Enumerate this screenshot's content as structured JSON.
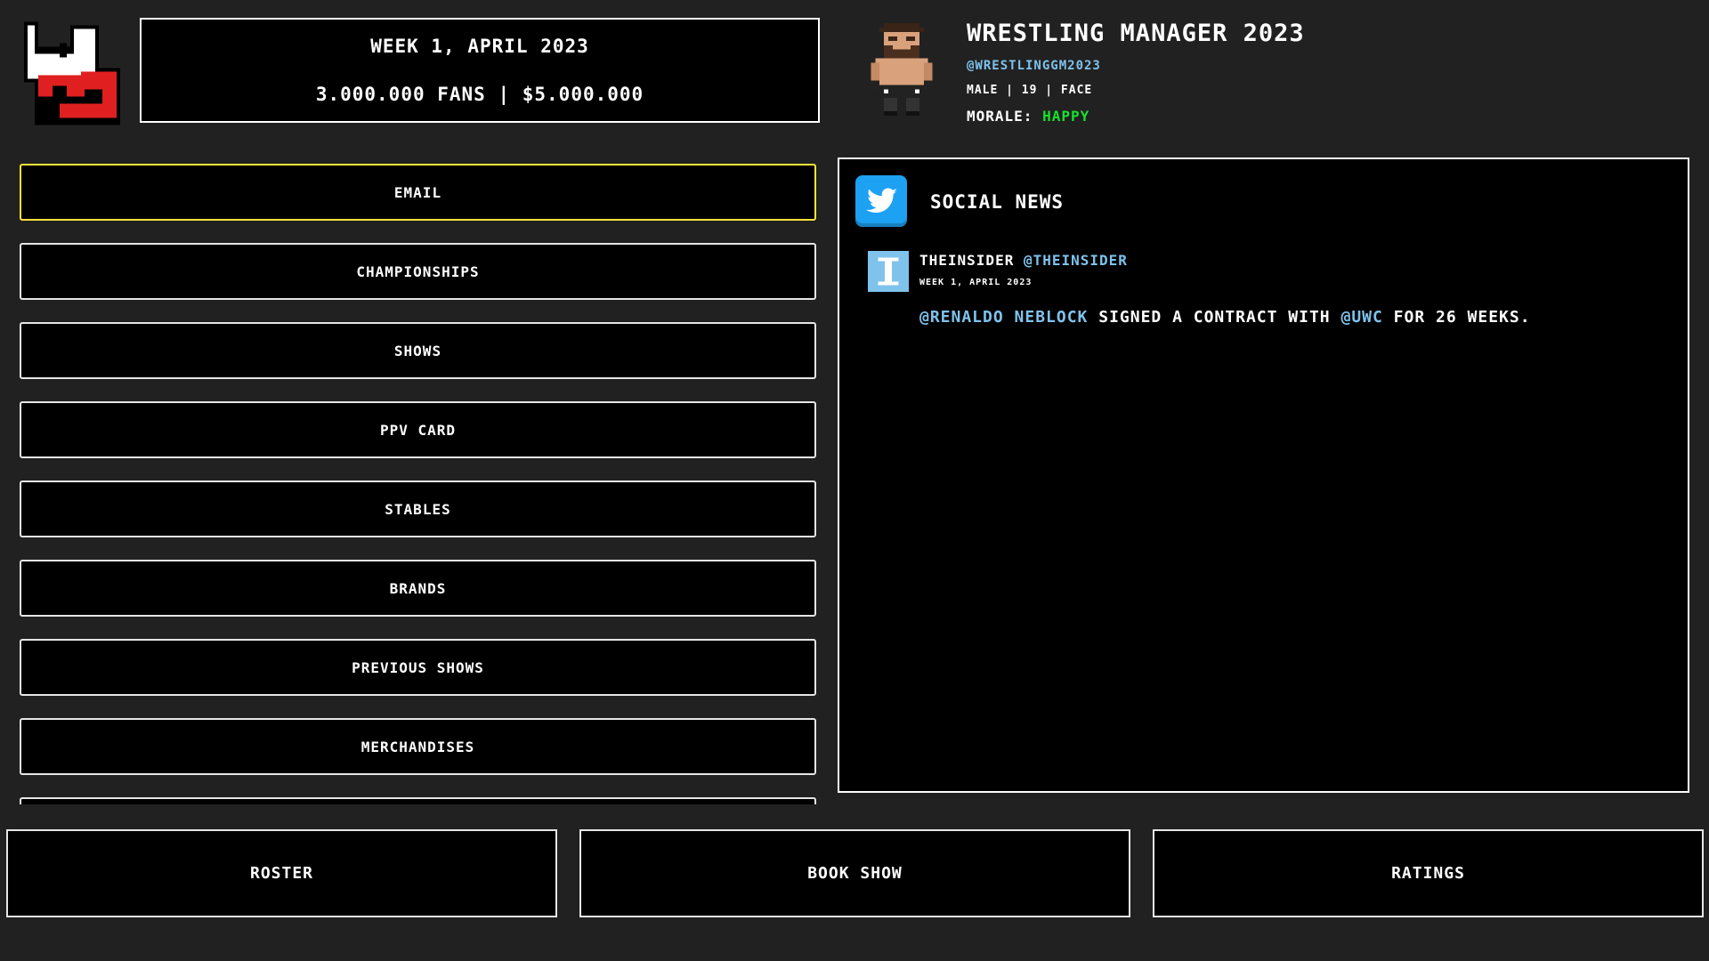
{
  "header": {
    "date_line": "WEEK 1, APRIL 2023",
    "stats_line": "3.000.000 FANS | $5.000.000"
  },
  "profile": {
    "name": "WRESTLING MANAGER 2023",
    "handle": "@WRESTLINGGM2023",
    "meta": "MALE | 19 | FACE",
    "morale_label": "MORALE:",
    "morale_value": "HAPPY"
  },
  "menu": {
    "items": [
      {
        "label": "EMAIL",
        "active": true
      },
      {
        "label": "CHAMPIONSHIPS"
      },
      {
        "label": "SHOWS"
      },
      {
        "label": "PPV CARD"
      },
      {
        "label": "STABLES"
      },
      {
        "label": "BRANDS"
      },
      {
        "label": "PREVIOUS SHOWS"
      },
      {
        "label": "MERCHANDISES"
      },
      {
        "label": ""
      }
    ]
  },
  "social": {
    "title": "SOCIAL NEWS",
    "post": {
      "author_name": "THEINSIDER",
      "author_handle": "@THEINSIDER",
      "date": "WEEK 1, APRIL 2023",
      "mention_1": "@RENALDO NEBLOCK",
      "text_1": " SIGNED A CONTRACT WITH ",
      "mention_2": "@UWC",
      "text_2": " FOR 26 WEEKS."
    }
  },
  "bottom": {
    "roster": "ROSTER",
    "book_show": "BOOK SHOW",
    "ratings": "RATINGS"
  },
  "icons": {
    "logo": "game-logo-icon",
    "avatar": "wrestler-avatar-icon",
    "bird": "twitter-bird-icon",
    "insider": "insider-i-icon"
  },
  "colors": {
    "background": "#212121",
    "accent_active": "#ffe23a",
    "mention": "#7fc2ec",
    "happy": "#19e12e",
    "twitter": "#1da1f2"
  }
}
